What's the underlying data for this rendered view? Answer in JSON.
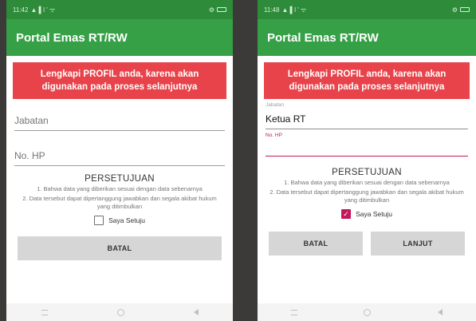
{
  "left": {
    "status": {
      "time": "11:42",
      "network": "▲ ▌l ' ᯤ",
      "battery_icon": "battery-icon"
    },
    "app_title": "Portal Emas RT/RW",
    "banner": "Lengkapi PROFIL anda, karena akan digunakan pada proses selanjutnya",
    "jabatan_placeholder": "Jabatan",
    "hp_placeholder": "No. HP",
    "agreement_title": "PERSETUJUAN",
    "agreement_item_1": "1. Bahwa data yang diberikan sesuai dengan data sebenarnya",
    "agreement_item_2": "2. Data tersebut dapat dipertanggung jawabkan dan segala akibat hukum yang ditimbulkan",
    "checkbox_label": "Saya Setuju",
    "checkbox_checked": false,
    "batal_label": "BATAL"
  },
  "right": {
    "status": {
      "time": "11:48",
      "network": "▲ ▌l ' ᯤ",
      "battery_icon": "battery-icon"
    },
    "app_title": "Portal Emas RT/RW",
    "banner": "Lengkapi PROFIL anda, karena akan digunakan pada proses selanjutnya",
    "jabatan_label": "Jabatan",
    "jabatan_value": "Ketua RT",
    "hp_label": "No. HP",
    "hp_value": "",
    "agreement_title": "PERSETUJUAN",
    "agreement_item_1": "1. Bahwa data yang diberikan sesuai dengan data sebenarnya",
    "agreement_item_2": "2. Data tersebut dapat dipertanggung jawabkan dan segala akibat hukum yang ditimbulkan",
    "checkbox_label": "Saya Setuju",
    "checkbox_checked": true,
    "check_mark": "✓",
    "batal_label": "BATAL",
    "lanjut_label": "LANJUT"
  },
  "colors": {
    "status_bar": "#2e8b3a",
    "app_bar": "#36a047",
    "banner": "#e8434a",
    "accent": "#c2185b",
    "button": "#d6d6d6"
  }
}
